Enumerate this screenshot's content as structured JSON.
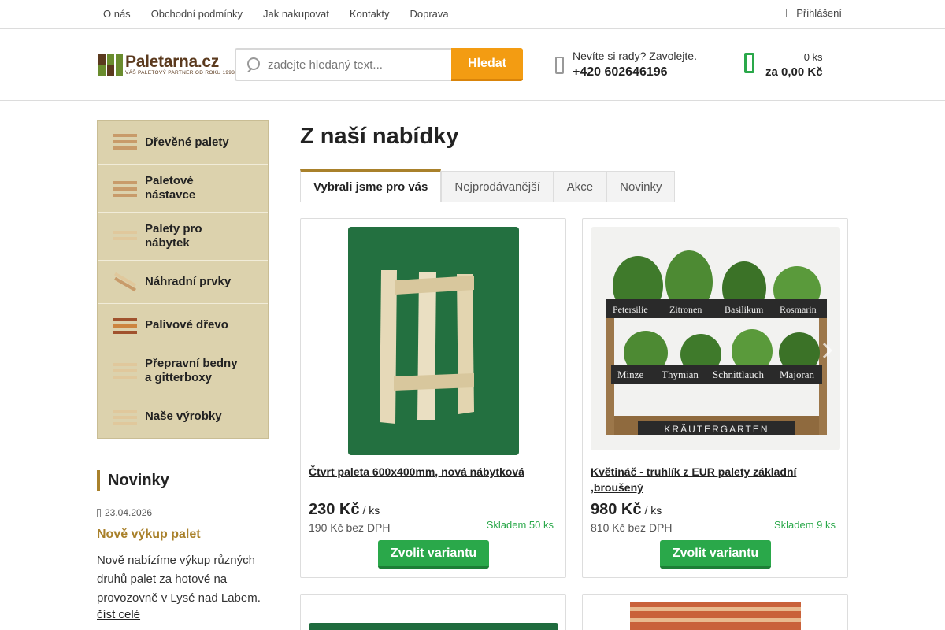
{
  "top_nav": [
    "O nás",
    "Obchodní podmínky",
    "Jak nakupovat",
    "Kontakty",
    "Doprava"
  ],
  "login": "Přihlášení",
  "logo": {
    "name": "Paletarna.cz",
    "tagline": "VÁŠ PALETOVÝ PARTNER OD ROKU 1993"
  },
  "search": {
    "placeholder": "zadejte hledaný text...",
    "button": "Hledat"
  },
  "phone": {
    "question": "Nevíte si rady? Zavolejte.",
    "number": "+420 602646196"
  },
  "cart": {
    "count": "0 ks",
    "total": "za 0,00 Kč"
  },
  "categories": [
    {
      "label": "Dřevěné palety"
    },
    {
      "label": "Paletové nástavce"
    },
    {
      "label": "Palety pro nábytek"
    },
    {
      "label": "Náhradní prvky"
    },
    {
      "label": "Palivové dřevo"
    },
    {
      "label": "Přepravní bedny a gitterboxy"
    },
    {
      "label": "Naše výrobky"
    }
  ],
  "news": {
    "heading": "Novinky",
    "date": "23.04.2026",
    "title": "Nově výkup palet",
    "text": "Nově nabízíme výkup různých druhů palet za hotové na provozovně v Lysé nad Labem.",
    "more": "číst celé"
  },
  "main": {
    "title": "Z naší nabídky",
    "tabs": [
      "Vybrali jsme pro vás",
      "Nejprodávanější",
      "Akce",
      "Novinky"
    ],
    "active_tab": 0
  },
  "products": [
    {
      "name": "Čtvrt paleta 600x400mm, nová nábytková",
      "price": "230 Kč",
      "unit": "/ ks",
      "price_no_vat": "190 Kč bez DPH",
      "stock": "Skladem 50 ks",
      "button": "Zvolit variantu"
    },
    {
      "name": "Květináč - truhlík z EUR palety základní ,broušený",
      "price": "980 Kč",
      "unit": "/ ks",
      "price_no_vat": "810 Kč bez DPH",
      "stock": "Skladem 9 ks",
      "button": "Zvolit variantu",
      "image_labels": [
        "Petersilie",
        "Zitronen",
        "Basilikum",
        "Rosmarin",
        "Minze",
        "Thymian",
        "Schnittlauch",
        "Majoran",
        "KRÄUTERGARTEN"
      ]
    }
  ],
  "colors": {
    "accent": "#a9812b",
    "orange": "#f39c12",
    "green": "#2aa84a",
    "sidebar": "#dcd2ad"
  }
}
